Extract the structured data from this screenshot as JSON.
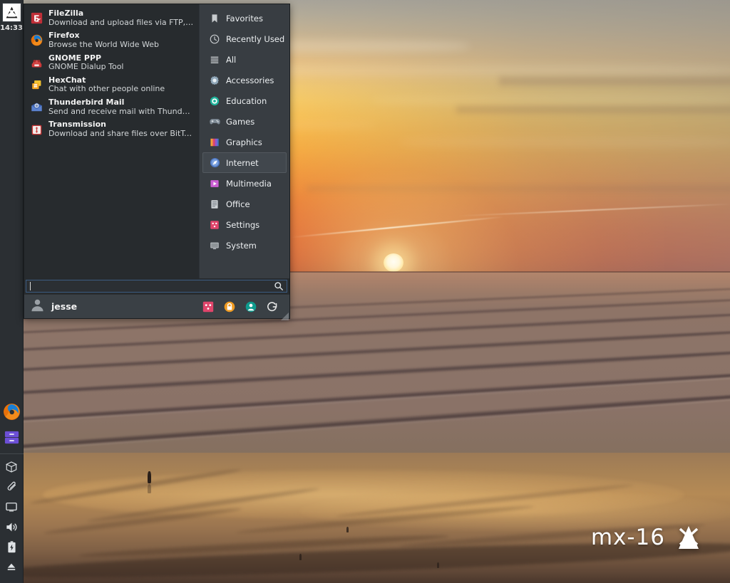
{
  "desktop": {
    "logo_text": "mx-16",
    "logo_icon": "mx-linux-logo-icon"
  },
  "panel": {
    "menu_button_icon": "mx-menu-icon",
    "clock": "14:33",
    "launchers": [
      {
        "name": "firefox",
        "icon": "firefox-icon"
      },
      {
        "name": "file-manager",
        "icon": "file-manager-icon"
      }
    ],
    "tray": [
      {
        "name": "package-updater",
        "icon": "package-box-icon"
      },
      {
        "name": "clipboard-manager",
        "icon": "paperclip-icon"
      },
      {
        "name": "display-settings",
        "icon": "monitor-icon"
      },
      {
        "name": "volume",
        "icon": "speaker-volume-icon"
      },
      {
        "name": "battery",
        "icon": "battery-icon"
      },
      {
        "name": "removable-media",
        "icon": "eject-icon"
      }
    ]
  },
  "menu": {
    "applications": [
      {
        "name": "FileZilla",
        "description": "Download and upload files via FTP, FTPS ...",
        "icon": "filezilla-icon"
      },
      {
        "name": "Firefox",
        "description": "Browse the World Wide Web",
        "icon": "firefox-icon"
      },
      {
        "name": "GNOME PPP",
        "description": "GNOME Dialup Tool",
        "icon": "gnome-ppp-icon"
      },
      {
        "name": "HexChat",
        "description": "Chat with other people online",
        "icon": "hexchat-icon"
      },
      {
        "name": "Thunderbird Mail",
        "description": "Send and receive mail with Thunderbird",
        "icon": "thunderbird-icon"
      },
      {
        "name": "Transmission",
        "description": "Download and share files over BitTorrent",
        "icon": "transmission-icon"
      }
    ],
    "categories": [
      {
        "label": "Favorites",
        "icon": "bookmark-icon",
        "active": false
      },
      {
        "label": "Recently Used",
        "icon": "clock-icon",
        "active": false
      },
      {
        "label": "All",
        "icon": "list-lines-icon",
        "active": false
      },
      {
        "label": "Accessories",
        "icon": "accessories-gear-icon",
        "active": false
      },
      {
        "label": "Education",
        "icon": "education-icon",
        "active": false
      },
      {
        "label": "Games",
        "icon": "gamepad-icon",
        "active": false
      },
      {
        "label": "Graphics",
        "icon": "graphics-icon",
        "active": false
      },
      {
        "label": "Internet",
        "icon": "compass-icon",
        "active": true
      },
      {
        "label": "Multimedia",
        "icon": "play-icon",
        "active": false
      },
      {
        "label": "Office",
        "icon": "document-icon",
        "active": false
      },
      {
        "label": "Settings",
        "icon": "settings-icon",
        "active": false
      },
      {
        "label": "System",
        "icon": "system-monitor-icon",
        "active": false
      }
    ],
    "search": {
      "value": "",
      "placeholder": "",
      "icon": "search-magnifier-icon"
    },
    "user": {
      "name": "jesse",
      "avatar_icon": "user-avatar-icon",
      "actions": [
        {
          "name": "settings-manager",
          "icon": "settings-square-icon",
          "color": "#e0456b"
        },
        {
          "name": "lock-screen",
          "icon": "lock-icon",
          "color": "#ef9b22"
        },
        {
          "name": "switch-user",
          "icon": "user-circle-icon",
          "color": "#0f9b8e"
        },
        {
          "name": "log-out",
          "icon": "logout-arrow-icon",
          "color": "#e8e8e8"
        }
      ]
    }
  },
  "colors": {
    "panel_bg": "#2b2f33",
    "menu_bg": "#2e3338",
    "app_list_bg": "#272b2e",
    "category_bg": "#383d42",
    "user_row_bg": "#3a4045",
    "accent_border": "#3c5c82",
    "text_primary": "#f2f2f2",
    "text_secondary": "#d2d6d8"
  }
}
